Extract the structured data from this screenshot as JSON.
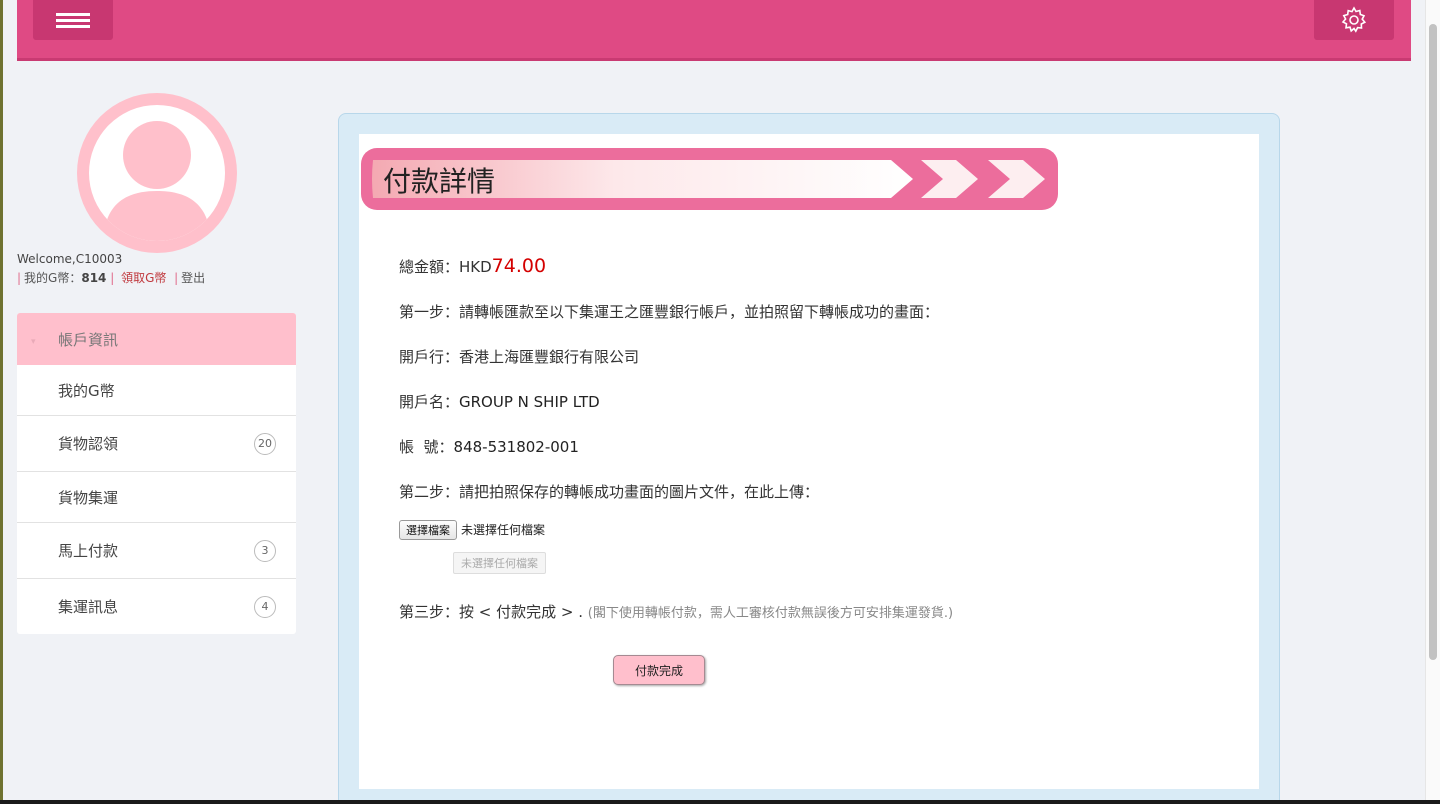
{
  "header": {
    "menu_icon": "hamburger-icon",
    "settings_icon": "gear-icon"
  },
  "user": {
    "welcome": "Welcome,C10003",
    "coins_label": "我的G幣：",
    "coins_value": "814",
    "claim_label": "領取G幣",
    "logout_label": "登出"
  },
  "sidebar": {
    "header": "帳戶資訊",
    "items": [
      {
        "label": "我的G幣",
        "badge": ""
      },
      {
        "label": "貨物認領",
        "badge": "20"
      },
      {
        "label": "貨物集運",
        "badge": ""
      },
      {
        "label": "馬上付款",
        "badge": "3"
      },
      {
        "label": "集運訊息",
        "badge": "4"
      }
    ]
  },
  "main": {
    "title": "付款詳情",
    "total_label": "總金額：HKD",
    "total_amount": "74.00",
    "step1": "第一步：請轉帳匯款至以下集運王之匯豐銀行帳戶，並拍照留下轉帳成功的畫面：",
    "bank_label": "開戶行：香港上海匯豐銀行有限公司",
    "account_name_label": "開戶名：",
    "account_name": "GROUP N SHIP LTD",
    "account_no_label": "帳  號：",
    "account_no": "848-531802-001",
    "step2": "第二步：請把拍照保存的轉帳成功畫面的圖片文件，在此上傳：",
    "file_button": "選擇檔案",
    "file_status": "未選擇任何檔案",
    "file_preview": "未選擇任何檔案",
    "step3": "第三步：按 < 付款完成 > .",
    "step3_note": "(閣下使用轉帳付款，需人工審核付款無誤後方可安排集運發貨.)",
    "submit_label": "付款完成"
  },
  "colors": {
    "brand_pink": "#df4a84",
    "light_pink": "#ffbfcc",
    "amount_red": "#d40000"
  }
}
